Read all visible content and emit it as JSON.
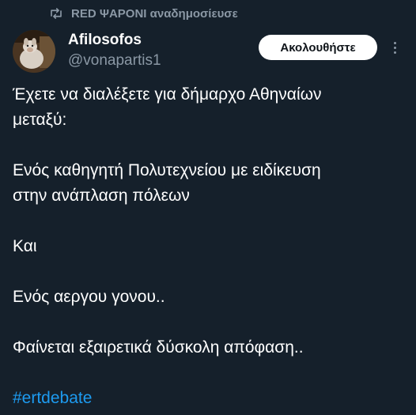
{
  "retweet": {
    "icon": "retweet-icon",
    "text": "RED ΨΑΡΟΝΙ αναδημοσίευσε"
  },
  "author": {
    "avatar": "avatar-image",
    "name": "Afilosofos",
    "handle": "@vonapartis1"
  },
  "actions": {
    "follow_label": "Ακολουθήστε",
    "more_icon": "more-vertical-icon"
  },
  "tweet": {
    "line1": "Έχετε να διαλέξετε για δήμαρχο Αθηναίων",
    "line2": "μεταξύ:",
    "line3": "Ενός καθηγητή Πολυτεχνείου με ειδίκευση",
    "line4": "στην ανάπλαση πόλεων",
    "line5": "Και",
    "line6": "Ενός αεργου γονου..",
    "line7": "Φαίνεται εξαιρετικά δύσκολη απόφαση..",
    "hashtag": "#ertdebate"
  },
  "colors": {
    "background": "#15202b",
    "muted": "#8b98a5",
    "link": "#1d9bf0"
  }
}
